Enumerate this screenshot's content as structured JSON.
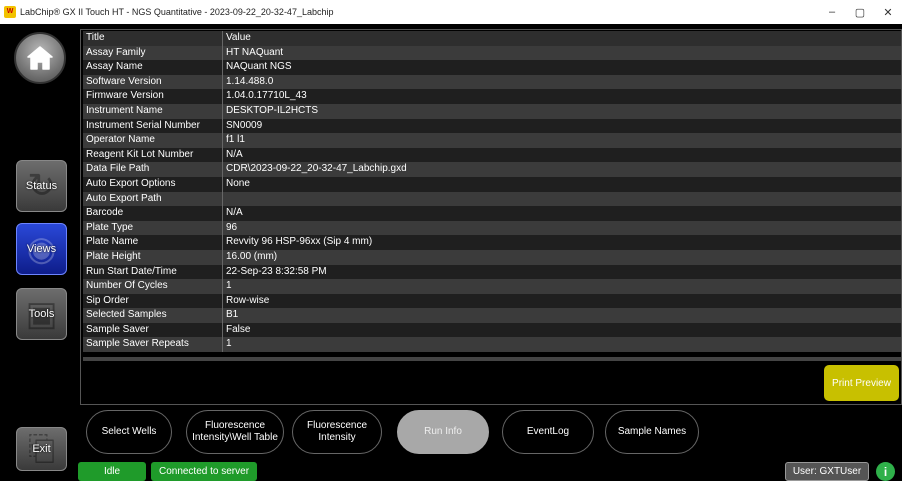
{
  "window": {
    "title": "LabChip® GX II Touch HT - NGS Quantitative - 2023-09-22_20-32-47_Labchip",
    "app_icon": "labchip-app-icon",
    "minimize_glyph": "–",
    "maximize_glyph": "▢",
    "close_glyph": "✕"
  },
  "nav": {
    "home_icon": "home-icon",
    "status": "Status",
    "views": "Views",
    "tools": "Tools",
    "exit": "Exit"
  },
  "table": {
    "header": {
      "title": "Title",
      "value": "Value"
    },
    "rows": [
      {
        "title": "Assay Family",
        "value": "HT NAQuant"
      },
      {
        "title": "Assay Name",
        "value": "NAQuant NGS"
      },
      {
        "title": "Software Version",
        "value": "1.14.488.0"
      },
      {
        "title": "Firmware Version",
        "value": "1.04.0.17710L_43"
      },
      {
        "title": "Instrument Name",
        "value": "DESKTOP-IL2HCTS"
      },
      {
        "title": "Instrument Serial Number",
        "value": "SN0009"
      },
      {
        "title": "Operator Name",
        "value": "f1 l1"
      },
      {
        "title": "Reagent Kit Lot Number",
        "value": "N/A"
      },
      {
        "title": "Data File Path",
        "value": "CDR\\2023-09-22_20-32-47_Labchip.gxd"
      },
      {
        "title": "Auto Export Options",
        "value": "None"
      },
      {
        "title": "Auto Export Path",
        "value": ""
      },
      {
        "title": "Barcode",
        "value": "N/A"
      },
      {
        "title": "Plate Type",
        "value": "96"
      },
      {
        "title": "Plate Name",
        "value": "Revvity 96 HSP-96xx  (Sip 4 mm)"
      },
      {
        "title": "Plate Height",
        "value": "16.00 (mm)"
      },
      {
        "title": "Run Start Date/Time",
        "value": "22-Sep-23 8:32:58 PM"
      },
      {
        "title": "Number Of Cycles",
        "value": "1"
      },
      {
        "title": "Sip Order",
        "value": "Row-wise"
      },
      {
        "title": "Selected Samples",
        "value": "B1"
      },
      {
        "title": "Sample Saver",
        "value": "False"
      },
      {
        "title": "Sample Saver Repeats",
        "value": "1"
      }
    ]
  },
  "print_preview": "Print Preview",
  "tabs": {
    "select_wells": "Select Wells",
    "fluorescence_intensity_well_table": "Fluorescence Intensity\\Well Table",
    "fluorescence_intensity": "Fluorescence Intensity",
    "run_info": "Run Info",
    "event_log": "EventLog",
    "sample_names": "Sample Names"
  },
  "status": {
    "state": "Idle",
    "connection": "Connected to server",
    "user": "User: GXTUser",
    "info_glyph": "i"
  },
  "colors": {
    "accent_yellow": "#c8c000",
    "status_green": "#1f9b2a",
    "views_blue": "#1a30b8"
  }
}
